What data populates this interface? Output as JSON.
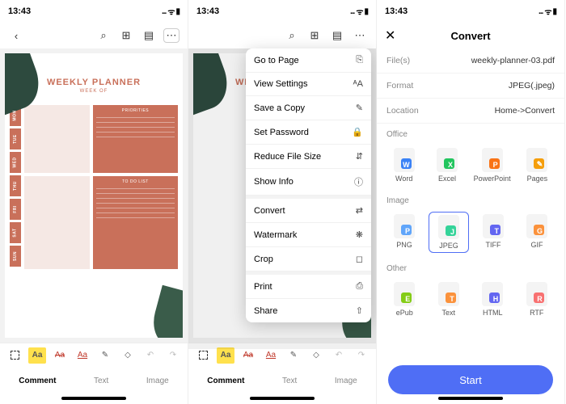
{
  "status": {
    "time": "13:43",
    "sig": "...",
    "wifi": "ᯤ",
    "batt": "▮"
  },
  "planner": {
    "title": "WEEKLY PLANNER",
    "subtitle": "WEEK OF",
    "days": [
      "MON",
      "TUE",
      "WED",
      "THU",
      "FRI",
      "SAT",
      "SUN"
    ],
    "box_priorities": "PRIORITIES",
    "box_todo": "TO DO LIST"
  },
  "anno_tabs": {
    "comment": "Comment",
    "text": "Text",
    "image": "Image"
  },
  "menu": [
    {
      "label": "Go to Page",
      "icon": "⎘"
    },
    {
      "label": "View Settings",
      "icon": "ᴬA"
    },
    {
      "label": "Save a Copy",
      "icon": "✎"
    },
    {
      "label": "Set Password",
      "icon": "🔒"
    },
    {
      "label": "Reduce File Size",
      "icon": "⇵"
    },
    {
      "label": "Show Info",
      "icon": "ⓘ"
    },
    {
      "sep": true
    },
    {
      "label": "Convert",
      "icon": "⇄"
    },
    {
      "label": "Watermark",
      "icon": "❋"
    },
    {
      "label": "Crop",
      "icon": "◻"
    },
    {
      "sep": true
    },
    {
      "label": "Print",
      "icon": "⎙"
    },
    {
      "label": "Share",
      "icon": "⇧"
    }
  ],
  "convert": {
    "title": "Convert",
    "file_label": "File(s)",
    "file_val": "weekly-planner-03.pdf",
    "format_label": "Format",
    "format_val": "JPEG(.jpeg)",
    "location_label": "Location",
    "location_val": "Home->Convert",
    "sec_office": "Office",
    "office": [
      {
        "name": "Word",
        "letter": "W",
        "color": "#3b82f6"
      },
      {
        "name": "Excel",
        "letter": "X",
        "color": "#22c55e"
      },
      {
        "name": "PowerPoint",
        "letter": "P",
        "color": "#f97316"
      },
      {
        "name": "Pages",
        "letter": "✎",
        "color": "#f59e0b"
      }
    ],
    "sec_image": "Image",
    "image": [
      {
        "name": "PNG",
        "letter": "P",
        "color": "#60a5fa"
      },
      {
        "name": "JPEG",
        "letter": "J",
        "color": "#34d399",
        "selected": true
      },
      {
        "name": "TIFF",
        "letter": "T",
        "color": "#6366f1"
      },
      {
        "name": "GIF",
        "letter": "G",
        "color": "#fb923c"
      }
    ],
    "sec_other": "Other",
    "other": [
      {
        "name": "ePub",
        "letter": "E",
        "color": "#84cc16"
      },
      {
        "name": "Text",
        "letter": "T",
        "color": "#fb923c"
      },
      {
        "name": "HTML",
        "letter": "H",
        "color": "#6366f1"
      },
      {
        "name": "RTF",
        "letter": "R",
        "color": "#f87171"
      }
    ],
    "start": "Start"
  }
}
